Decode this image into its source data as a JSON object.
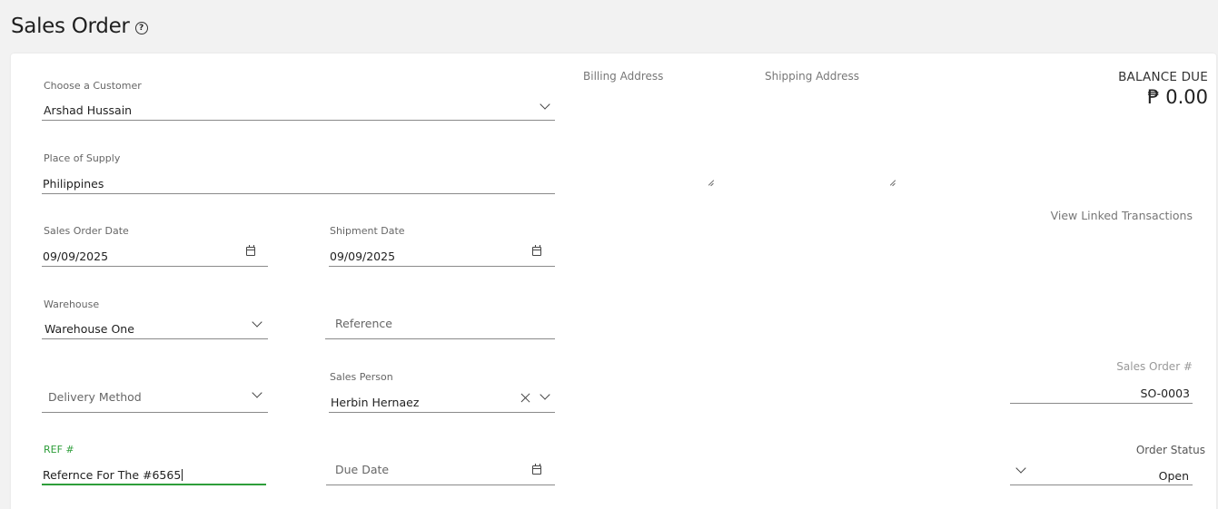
{
  "page": {
    "title": "Sales Order"
  },
  "customer": {
    "label": "Choose a Customer",
    "value": "Arshad Hussain"
  },
  "place_of_supply": {
    "label": "Place of Supply",
    "value": "Philippines"
  },
  "sales_order_date": {
    "label": "Sales Order Date",
    "value": "09/09/2025"
  },
  "shipment_date": {
    "label": "Shipment Date",
    "value": "09/09/2025"
  },
  "warehouse": {
    "label": "Warehouse",
    "value": "Warehouse One"
  },
  "reference": {
    "placeholder": "Reference"
  },
  "delivery_method": {
    "placeholder": "Delivery Method"
  },
  "sales_person": {
    "label": "Sales Person",
    "value": "Herbin Hernaez"
  },
  "ref_number": {
    "label": "REF #",
    "value": "Refernce For The #6565"
  },
  "due_date": {
    "placeholder": "Due Date"
  },
  "addresses": {
    "billing_label": "Billing Address",
    "shipping_label": "Shipping Address"
  },
  "balance": {
    "label": "BALANCE DUE",
    "value": "₱ 0.00"
  },
  "links": {
    "view_linked": "View Linked Transactions"
  },
  "sales_order_number": {
    "label": "Sales Order #",
    "value": "SO-0003"
  },
  "order_status": {
    "label": "Order Status",
    "value": "Open"
  },
  "colors": {
    "accent": "#2e9e3a",
    "background": "#f2f2f2",
    "card": "#ffffff"
  },
  "icons": [
    "help-icon",
    "chevron-down-icon",
    "calendar-icon",
    "close-icon",
    "resize-handle-icon"
  ]
}
